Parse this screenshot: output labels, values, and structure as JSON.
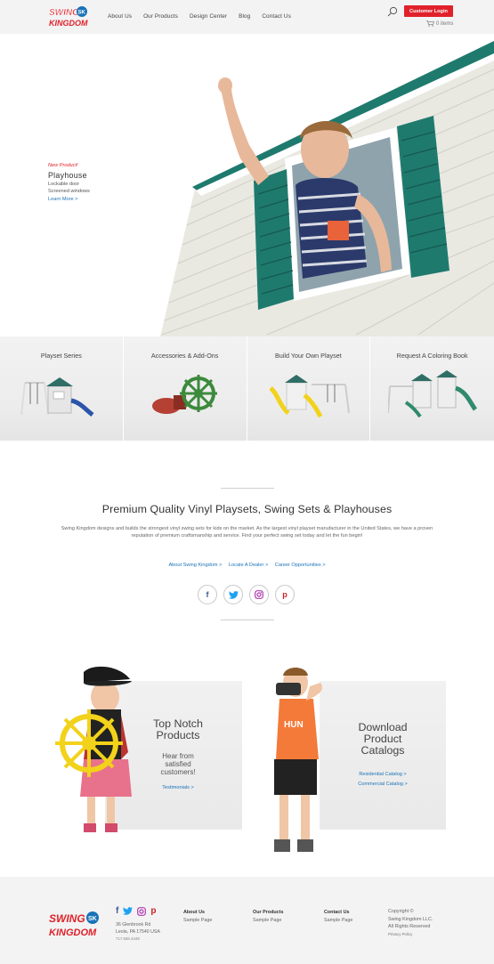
{
  "header": {
    "logo_top": "SWING",
    "logo_badge": "SK",
    "logo_bottom": "KINGDOM",
    "nav": [
      "About Us",
      "Our Products",
      "Design Center",
      "Blog",
      "Contact Us"
    ],
    "login_label": "Customer Login",
    "cart_label": "0 items"
  },
  "hero": {
    "new_label": "New Product!",
    "title": "Playhouse",
    "line1": "Lockable door",
    "line2": "Screened windows",
    "link": "Learn More >"
  },
  "cards": [
    {
      "title": "Playset Series"
    },
    {
      "title": "Accessories & Add-Ons"
    },
    {
      "title": "Build Your Own Playset"
    },
    {
      "title": "Request A Coloring Book"
    }
  ],
  "intro": {
    "title": "Premium Quality Vinyl Playsets, Swing Sets & Playhouses",
    "body": "Swing Kingdom designs and builds the strongest vinyl swing sets for kids on the market. As the largest vinyl playset manufacturer in the United States, we have a proven reputation of premium craftsmanship and service. Find your perfect swing set today and let the fun begin!",
    "links": [
      "About Swing Kingdom >",
      "Locate A Dealer >",
      "Career Opportunities >"
    ]
  },
  "social": [
    "f",
    "t",
    "i",
    "p"
  ],
  "promo_left": {
    "title_line1": "Top Notch",
    "title_line2": "Products",
    "sub_line1": "Hear from",
    "sub_line2": "satisfied",
    "sub_line3": "customers!",
    "link": "Testimonials >"
  },
  "promo_right": {
    "title_line1": "Download",
    "title_line2": "Product",
    "title_line3": "Catalogs",
    "link1": "Residential Catalog >",
    "link2": "Commercial Catalog >"
  },
  "footer": {
    "address1": "36 Glenbrook Rd",
    "address2": "Leola, PA 17540 USA",
    "phone": "717.656.4449",
    "col1_title": "About Us",
    "col1_item": "Sample Page",
    "col2_title": "Our Products",
    "col2_item": "Sample Page",
    "col3_title": "Contact Us",
    "col3_item": "Sample Page",
    "copy1": "Copyright ©",
    "copy2": "Swing Kingdom LLC.",
    "copy3": "All Rights Reserved",
    "privacy": "Privacy Policy"
  },
  "colors": {
    "brand_red": "#e0212a",
    "link_blue": "#1a73b8",
    "shutter_green": "#1f7a6e"
  }
}
